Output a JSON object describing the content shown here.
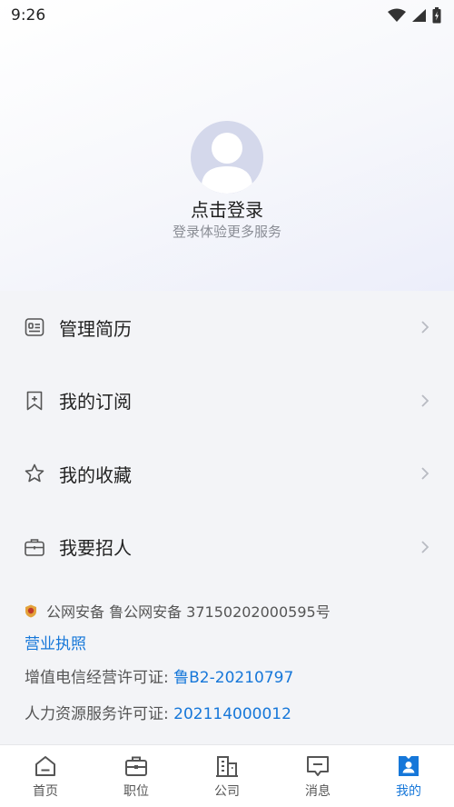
{
  "status_bar": {
    "time": "9:26"
  },
  "profile": {
    "login_title": "点击登录",
    "login_subtitle": "登录体验更多服务"
  },
  "menu": {
    "items": [
      {
        "label": "管理简历",
        "icon": "resume-icon"
      },
      {
        "label": "我的订阅",
        "icon": "bookmark-icon"
      },
      {
        "label": "我的收藏",
        "icon": "star-icon"
      },
      {
        "label": "我要招人",
        "icon": "briefcase-icon"
      }
    ]
  },
  "footer": {
    "police_record": "公网安备 鲁公网安备 37150202000595号",
    "business_license": "营业执照",
    "telecom_label": "增值电信经营许可证: ",
    "telecom_value": "鲁B2-20210797",
    "hr_label": "人力资源服务许可证: ",
    "hr_value": "202114000012"
  },
  "bottom_nav": {
    "items": [
      {
        "label": "首页",
        "icon": "home-icon"
      },
      {
        "label": "职位",
        "icon": "briefcase-icon"
      },
      {
        "label": "公司",
        "icon": "building-icon"
      },
      {
        "label": "消息",
        "icon": "message-icon"
      },
      {
        "label": "我的",
        "icon": "profile-icon",
        "active": true
      }
    ]
  },
  "colors": {
    "accent": "#1677d9",
    "background": "#f3f4f7"
  }
}
